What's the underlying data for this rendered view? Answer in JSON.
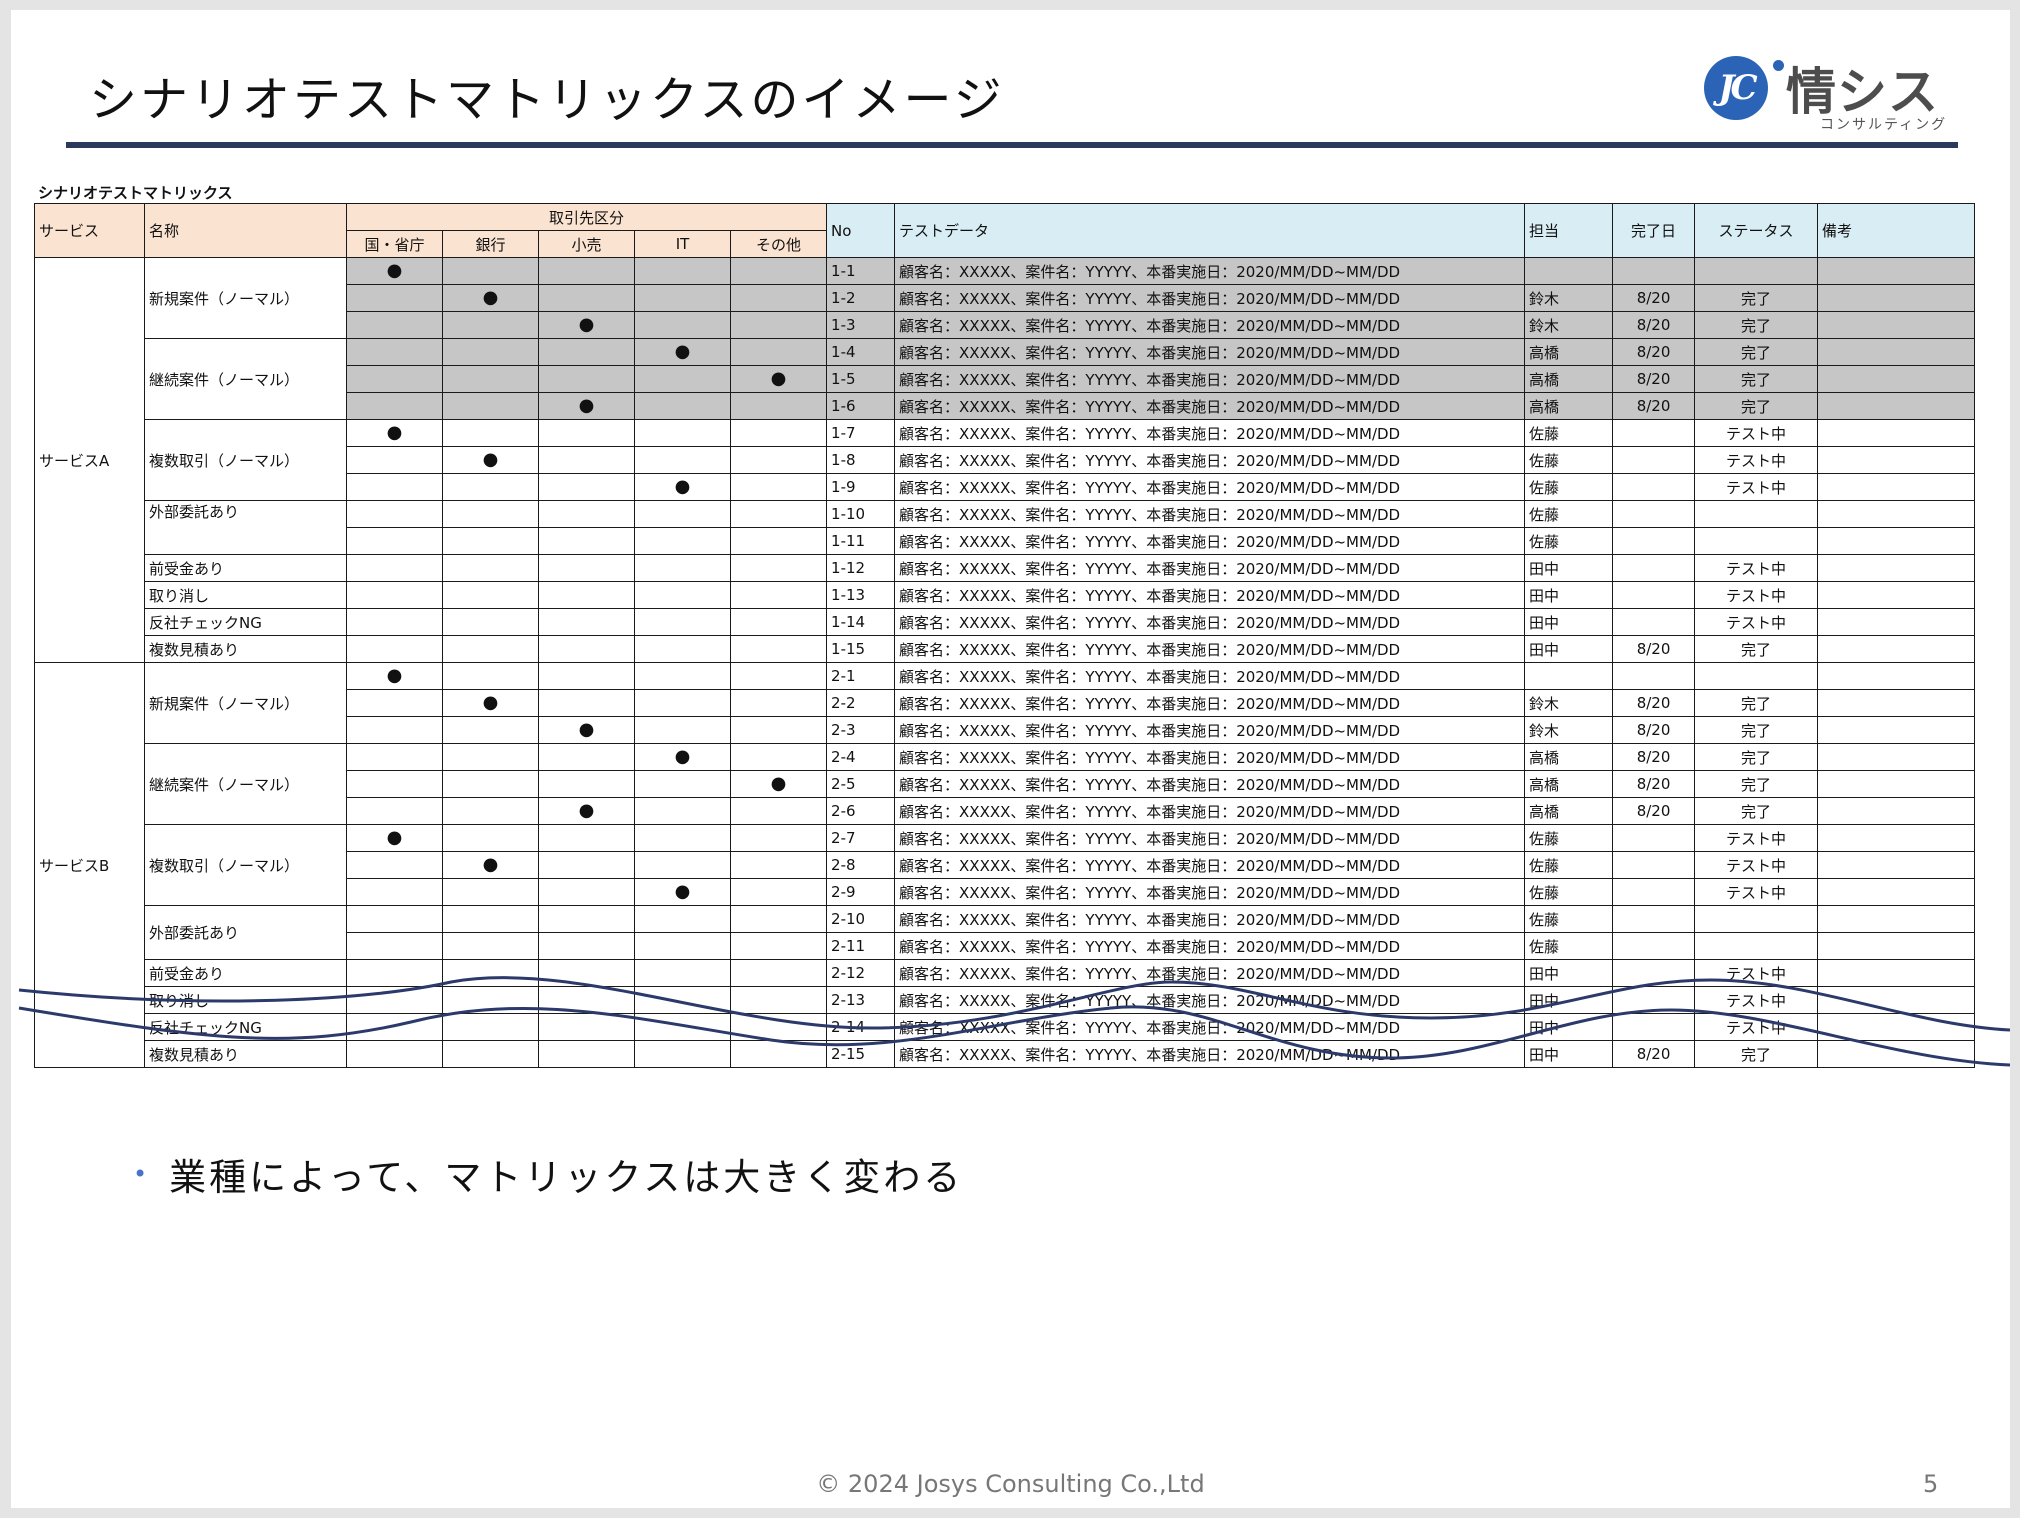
{
  "slide": {
    "title": "シナリオテストマトリックスのイメージ",
    "logo": {
      "mark": "JC",
      "name": "情シス",
      "sub": "コンサルティング"
    },
    "matrix_caption": "シナリオテストマトリックス",
    "bullet": "業種によって、マトリックスは大きく変わる",
    "footer": "© 2024 Josys Consulting Co.,Ltd",
    "page_number": "5"
  },
  "table": {
    "headers": {
      "service": "サービス",
      "name": "名称",
      "client_group": "取引先区分",
      "client_types": [
        "国・省庁",
        "銀行",
        "小売",
        "IT",
        "その他"
      ],
      "no": "No",
      "test_data": "テストデータ",
      "owner": "担当",
      "done_date": "完了日",
      "status": "ステータス",
      "note": "備考"
    },
    "mark_symbol": "●",
    "test_data_text": "顧客名：XXXXX、案件名：YYYYY、本番実施日：2020/MM/DD~MM/DD",
    "services": [
      {
        "label": "サービスA",
        "groups": [
          {
            "name": "新規案件（ノーマル）",
            "rows": [
              {
                "mark": 0,
                "no": "1-1",
                "owner": "",
                "date": "",
                "status": "",
                "shaded": true
              },
              {
                "mark": 1,
                "no": "1-2",
                "owner": "鈴木",
                "date": "8/20",
                "status": "完了",
                "shaded": true
              },
              {
                "mark": 2,
                "no": "1-3",
                "owner": "鈴木",
                "date": "8/20",
                "status": "完了",
                "shaded": true
              }
            ]
          },
          {
            "name": "継続案件（ノーマル）",
            "rows": [
              {
                "mark": 3,
                "no": "1-4",
                "owner": "高橋",
                "date": "8/20",
                "status": "完了",
                "shaded": true
              },
              {
                "mark": 4,
                "no": "1-5",
                "owner": "高橋",
                "date": "8/20",
                "status": "完了",
                "shaded": true
              },
              {
                "mark": 2,
                "no": "1-6",
                "owner": "高橋",
                "date": "8/20",
                "status": "完了",
                "shaded": true
              }
            ]
          },
          {
            "name": "複数取引（ノーマル）",
            "rows": [
              {
                "mark": 0,
                "no": "1-7",
                "owner": "佐藤",
                "date": "",
                "status": "テスト中"
              },
              {
                "mark": 1,
                "no": "1-8",
                "owner": "佐藤",
                "date": "",
                "status": "テスト中"
              },
              {
                "mark": 3,
                "no": "1-9",
                "owner": "佐藤",
                "date": "",
                "status": "テスト中"
              }
            ]
          },
          {
            "name": "外部委託あり",
            "align": "top",
            "rows": [
              {
                "mark": -1,
                "no": "1-10",
                "owner": "佐藤",
                "date": "",
                "status": ""
              },
              {
                "mark": -1,
                "no": "1-11",
                "owner": "佐藤",
                "date": "",
                "status": ""
              }
            ]
          },
          {
            "name": "前受金あり",
            "rows": [
              {
                "mark": -1,
                "no": "1-12",
                "owner": "田中",
                "date": "",
                "status": "テスト中"
              }
            ]
          },
          {
            "name": "取り消し",
            "rows": [
              {
                "mark": -1,
                "no": "1-13",
                "owner": "田中",
                "date": "",
                "status": "テスト中"
              }
            ]
          },
          {
            "name": "反社チェックNG",
            "rows": [
              {
                "mark": -1,
                "no": "1-14",
                "owner": "田中",
                "date": "",
                "status": "テスト中"
              }
            ]
          },
          {
            "name": "複数見積あり",
            "rows": [
              {
                "mark": -1,
                "no": "1-15",
                "owner": "田中",
                "date": "8/20",
                "status": "完了"
              }
            ]
          }
        ]
      },
      {
        "label": "サービスB",
        "groups": [
          {
            "name": "新規案件（ノーマル）",
            "rows": [
              {
                "mark": 0,
                "no": "2-1",
                "owner": "",
                "date": "",
                "status": ""
              },
              {
                "mark": 1,
                "no": "2-2",
                "owner": "鈴木",
                "date": "8/20",
                "status": "完了"
              },
              {
                "mark": 2,
                "no": "2-3",
                "owner": "鈴木",
                "date": "8/20",
                "status": "完了"
              }
            ]
          },
          {
            "name": "継続案件（ノーマル）",
            "rows": [
              {
                "mark": 3,
                "no": "2-4",
                "owner": "高橋",
                "date": "8/20",
                "status": "完了"
              },
              {
                "mark": 4,
                "no": "2-5",
                "owner": "高橋",
                "date": "8/20",
                "status": "完了"
              },
              {
                "mark": 2,
                "no": "2-6",
                "owner": "高橋",
                "date": "8/20",
                "status": "完了"
              }
            ]
          },
          {
            "name": "複数取引（ノーマル）",
            "rows": [
              {
                "mark": 0,
                "no": "2-7",
                "owner": "佐藤",
                "date": "",
                "status": "テスト中"
              },
              {
                "mark": 1,
                "no": "2-8",
                "owner": "佐藤",
                "date": "",
                "status": "テスト中"
              },
              {
                "mark": 3,
                "no": "2-9",
                "owner": "佐藤",
                "date": "",
                "status": "テスト中"
              }
            ]
          },
          {
            "name": "外部委託あり",
            "rows": [
              {
                "mark": -1,
                "no": "2-10",
                "owner": "佐藤",
                "date": "",
                "status": ""
              },
              {
                "mark": -1,
                "no": "2-11",
                "owner": "佐藤",
                "date": "",
                "status": ""
              }
            ]
          },
          {
            "name": "前受金あり",
            "rows": [
              {
                "mark": -1,
                "no": "2-12",
                "owner": "田中",
                "date": "",
                "status": "テスト中"
              }
            ]
          },
          {
            "name": "取り消し",
            "rows": [
              {
                "mark": -1,
                "no": "2-13",
                "owner": "田中",
                "date": "",
                "status": "テスト中"
              }
            ]
          },
          {
            "name": "反社チェックNG",
            "rows": [
              {
                "mark": -1,
                "no": "2-14",
                "owner": "田中",
                "date": "",
                "status": "テスト中"
              }
            ]
          },
          {
            "name": "複数見積あり",
            "rows": [
              {
                "mark": -1,
                "no": "2-15",
                "owner": "田中",
                "date": "8/20",
                "status": "完了"
              }
            ]
          }
        ]
      }
    ]
  },
  "colors": {
    "header_left_bg": "#fbe3d1",
    "header_right_bg": "#d9edf4",
    "shaded_row_bg": "#c6c6c6",
    "title_rule": "#2b3a5c",
    "brand_blue": "#2b64b6",
    "wave_line": "#2b3a6b",
    "bullet": "#4a73c8"
  }
}
